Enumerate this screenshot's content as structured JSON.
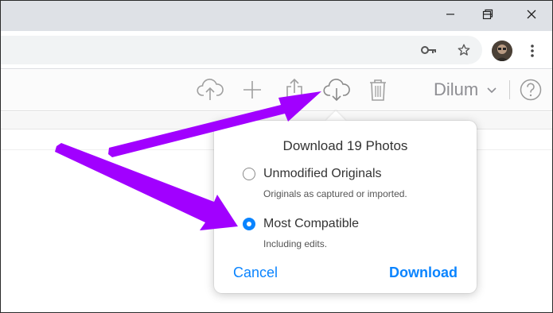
{
  "browser": {
    "window_controls": {
      "minimize_icon": "minimize-icon",
      "restore_icon": "restore-icon",
      "close_icon": "close-icon"
    },
    "omnibox_icons": [
      "key-icon",
      "star-icon"
    ],
    "menu_icon": "more-vertical-icon"
  },
  "app_toolbar": {
    "icons": [
      "upload-icon",
      "add-icon",
      "share-icon",
      "download-icon",
      "trash-icon",
      "help-icon"
    ],
    "user_name": "Dilum",
    "user_chevron": "chevron-down-icon"
  },
  "download_popover": {
    "title": "Download 19 Photos",
    "options": [
      {
        "label": "Unmodified Originals",
        "description": "Originals as captured or imported.",
        "selected": false
      },
      {
        "label": "Most Compatible",
        "description": "Including edits.",
        "selected": true
      }
    ],
    "cancel_label": "Cancel",
    "download_label": "Download"
  },
  "annotation": {
    "arrow_color": "#a100ff",
    "arrow_count": 2
  },
  "colors": {
    "accent": "#0a84ff",
    "titlebar": "#dee1e6",
    "omnibox": "#f1f3f4",
    "icon_gray": "#9a9a9a"
  }
}
